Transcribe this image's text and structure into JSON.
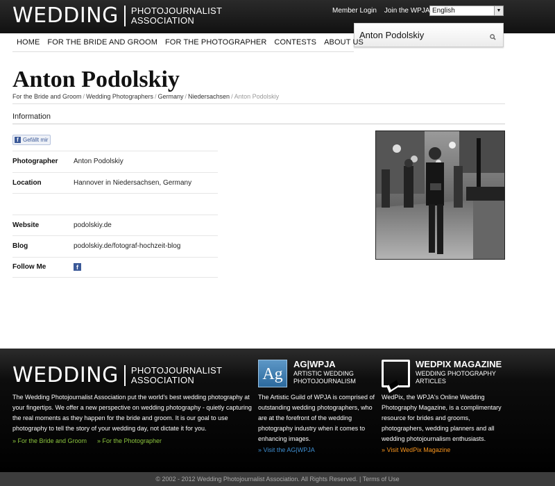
{
  "header": {
    "logo_big": "WEDDING",
    "logo_small_line1": "PHOTOJOURNALIST",
    "logo_small_line2": "ASSOCIATION",
    "member_login": "Member Login",
    "join": "Join the WPJA",
    "language_selected": "English",
    "search_value": "Anton Podolskiy"
  },
  "nav": [
    "HOME",
    "FOR THE BRIDE AND GROOM",
    "FOR THE PHOTOGRAPHER",
    "CONTESTS",
    "ABOUT US"
  ],
  "page": {
    "title": "Anton Podolskiy",
    "breadcrumbs": [
      "For the Bride and Groom",
      "Wedding Photographers",
      "Germany",
      "Niedersachsen",
      "Anton Podolskiy"
    ],
    "section": "Information",
    "fb_like": "Gefällt mir"
  },
  "info": {
    "photographer_label": "Photographer",
    "photographer": "Anton Podolskiy",
    "location_label": "Location",
    "location": "Hannover in Niedersachsen, Germany",
    "website_label": "Website",
    "website": "podolskiy.de",
    "blog_label": "Blog",
    "blog": "podolskiy.de/fotograf-hochzeit-blog",
    "follow_label": "Follow Me",
    "follow_icon": "facebook-icon"
  },
  "footer": {
    "about_text": "The Wedding Photojournalist Association put the world's best wedding photography at your fingertips. We offer a new perspective on wedding photography - quietly capturing the real moments as they happen for the bride and groom. It is our goal to use photography to tell the story of your wedding day, not dictate it for you.",
    "link_bride": "» For the Bride and Groom",
    "link_photographer": "» For the Photographer",
    "ag_logo": "Ag",
    "ag_title": "AG|WPJA",
    "ag_sub1": "ARTISTIC WEDDING",
    "ag_sub2": "PHOTOJOURNALISM",
    "ag_text": "The Artistic Guild of WPJA is comprised of outstanding wedding photographers, who are at the forefront of the wedding photography industry when it comes to enhancing images.",
    "ag_link": "» Visit the AG|WPJA",
    "wp_title": "WEDPIX MAGAZINE",
    "wp_sub1": "WEDDING PHOTOGRAPHY",
    "wp_sub2": "ARTICLES",
    "wp_text": "WedPix, the WPJA's Online Wedding Photography Magazine, is a complimentary resource for brides and grooms, photographers, wedding planners and all wedding photojournalism enthusiasts.",
    "wp_link": "» Visit WedPix Magazine",
    "copyright": "© 2002 - 2012 Wedding Photojournalist Association. All Rights Reserved. | Terms of Use"
  },
  "colors": {
    "footer_link_green": "#8dc63f",
    "footer_link_blue": "#3e8ed0",
    "footer_link_orange": "#f7941d",
    "facebook_blue": "#3b5998"
  }
}
